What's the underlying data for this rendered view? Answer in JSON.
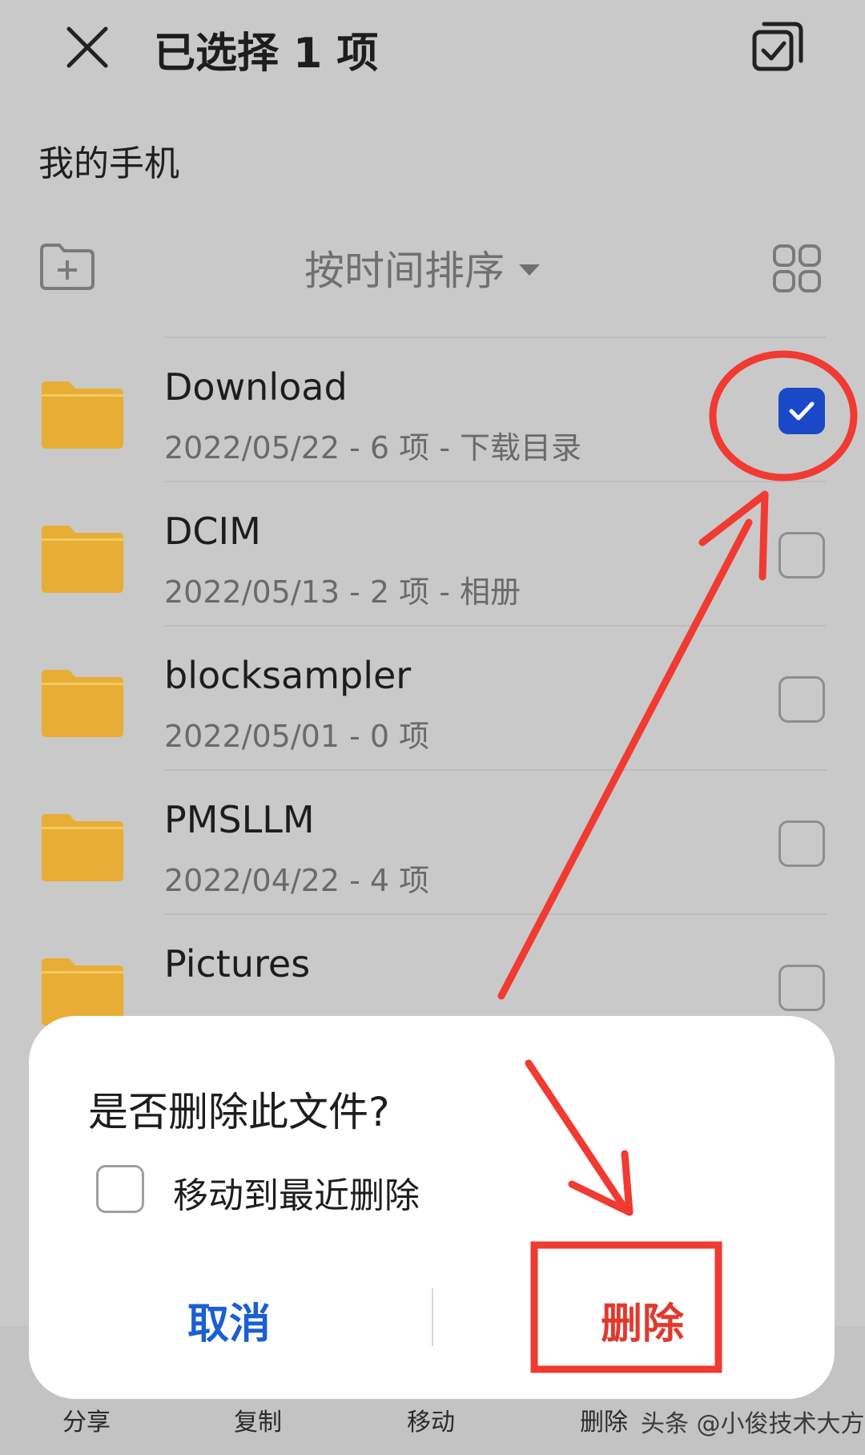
{
  "header": {
    "title": "已选择 1 项",
    "close_icon": "close-icon",
    "select_all_icon": "select-all-icon"
  },
  "location": "我的手机",
  "toolbar": {
    "new_folder_icon": "new-folder-icon",
    "sort_label": "按时间排序",
    "view_icon": "grid-view-icon"
  },
  "files": [
    {
      "name": "Download",
      "meta": "2022/05/22 - 6 项 - 下载目录",
      "checked": true
    },
    {
      "name": "DCIM",
      "meta": "2022/05/13 - 2 项 - 相册",
      "checked": false
    },
    {
      "name": "blocksampler",
      "meta": "2022/05/01 - 0 项",
      "checked": false
    },
    {
      "name": "PMSLLM",
      "meta": "2022/04/22 - 4 项",
      "checked": false
    },
    {
      "name": "Pictures",
      "meta": "",
      "checked": false
    }
  ],
  "bottom_bar": {
    "share": "分享",
    "copy": "复制",
    "move": "移动",
    "delete": "删除"
  },
  "watermark": "头条 @小俊技术大方",
  "dialog": {
    "title": "是否删除此文件?",
    "checkbox_label": "移动到最近删除",
    "cancel": "取消",
    "confirm": "删除"
  },
  "colors": {
    "accent_blue": "#1a5fd4",
    "checkbox_blue": "#1a49c8",
    "delete_red": "#e03a2e",
    "annotation_red": "#f03a32",
    "folder_yellow": "#e8ad35"
  }
}
